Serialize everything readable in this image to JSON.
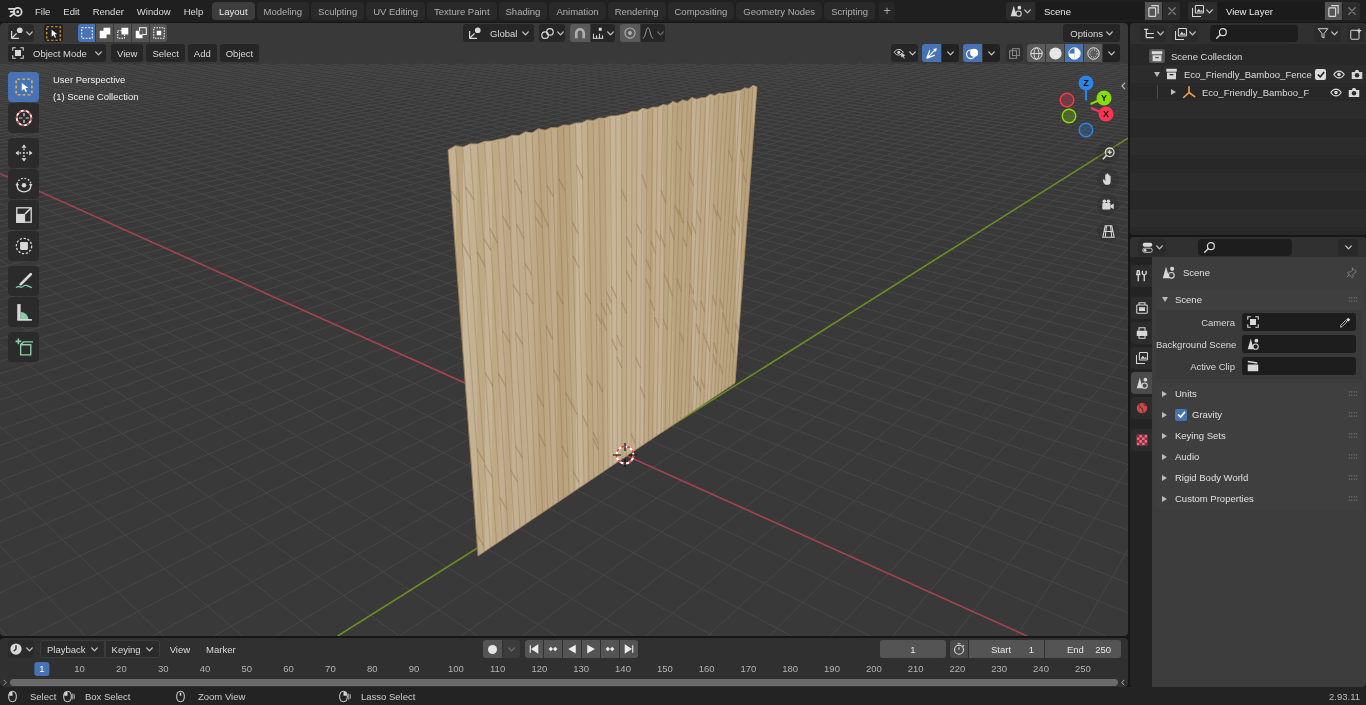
{
  "top_bar": {
    "menus": [
      "File",
      "Edit",
      "Render",
      "Window",
      "Help"
    ],
    "workspaces": [
      {
        "label": "Layout",
        "selected": true
      },
      {
        "label": "Modeling",
        "selected": false
      },
      {
        "label": "Sculpting",
        "selected": false
      },
      {
        "label": "UV Editing",
        "selected": false
      },
      {
        "label": "Texture Paint",
        "selected": false
      },
      {
        "label": "Shading",
        "selected": false
      },
      {
        "label": "Animation",
        "selected": false
      },
      {
        "label": "Rendering",
        "selected": false
      },
      {
        "label": "Compositing",
        "selected": false
      },
      {
        "label": "Geometry Nodes",
        "selected": false
      },
      {
        "label": "Scripting",
        "selected": false
      }
    ],
    "add_workspace": "+",
    "scene": "Scene",
    "view_layer": "View Layer"
  },
  "viewport": {
    "select_modes": [
      {
        "selected": true
      },
      {
        "selected": false
      },
      {
        "selected": false
      },
      {
        "selected": false
      },
      {
        "selected": false
      }
    ],
    "transform_orientation": "Global",
    "snap": false,
    "proportional_editing": false,
    "options": "Options",
    "mode": "Object Mode",
    "menus": [
      "View",
      "Select",
      "Add",
      "Object"
    ],
    "gizmos": true,
    "overlays": true,
    "xray": false,
    "shading": [
      {
        "kind": "wireframe",
        "selected": false
      },
      {
        "kind": "solid",
        "selected": false
      },
      {
        "kind": "material",
        "selected": true
      },
      {
        "kind": "rendered",
        "selected": false
      }
    ],
    "tool_groups": [
      {
        "tools": [
          {
            "kind": "select-box",
            "selected": true
          },
          {
            "kind": "cursor",
            "selected": false
          }
        ]
      },
      {
        "tools": [
          {
            "kind": "move",
            "selected": false
          },
          {
            "kind": "rotate",
            "selected": false
          },
          {
            "kind": "scale",
            "selected": false
          },
          {
            "kind": "transform",
            "selected": false
          }
        ]
      },
      {
        "tools": [
          {
            "kind": "annotate",
            "selected": false
          },
          {
            "kind": "measure",
            "selected": false
          }
        ]
      },
      {
        "tools": [
          {
            "kind": "add-cube",
            "selected": false
          }
        ]
      }
    ],
    "info": [
      "User Perspective",
      "(1) Scene Collection"
    ],
    "axes": [
      {
        "label": "Z",
        "color": "#2f83e3"
      },
      {
        "label": "Y",
        "color": "#8bdc00"
      },
      {
        "label": "X",
        "color": "#ff3352"
      }
    ]
  },
  "timeline": {
    "menus": [
      {
        "label": "Playback",
        "kind": "dropdown"
      },
      {
        "label": "Keying",
        "kind": "dropdown"
      },
      {
        "label": "View",
        "kind": "menu"
      },
      {
        "label": "Marker",
        "kind": "menu"
      }
    ],
    "auto_keying": false,
    "current_frame": "1",
    "start_label": "Start",
    "start": "1",
    "end_label": "End",
    "end": "250",
    "ruler": [
      {
        "label": "1",
        "selected": true
      },
      {
        "label": "10",
        "selected": false
      },
      {
        "label": "20",
        "selected": false
      },
      {
        "label": "30",
        "selected": false
      },
      {
        "label": "40",
        "selected": false
      },
      {
        "label": "50",
        "selected": false
      },
      {
        "label": "60",
        "selected": false
      },
      {
        "label": "70",
        "selected": false
      },
      {
        "label": "80",
        "selected": false
      },
      {
        "label": "90",
        "selected": false
      },
      {
        "label": "100",
        "selected": false
      },
      {
        "label": "110",
        "selected": false
      },
      {
        "label": "120",
        "selected": false
      },
      {
        "label": "130",
        "selected": false
      },
      {
        "label": "140",
        "selected": false
      },
      {
        "label": "150",
        "selected": false
      },
      {
        "label": "160",
        "selected": false
      },
      {
        "label": "170",
        "selected": false
      },
      {
        "label": "180",
        "selected": false
      },
      {
        "label": "190",
        "selected": false
      },
      {
        "label": "200",
        "selected": false
      },
      {
        "label": "210",
        "selected": false
      },
      {
        "label": "220",
        "selected": false
      },
      {
        "label": "230",
        "selected": false
      },
      {
        "label": "240",
        "selected": false
      },
      {
        "label": "250",
        "selected": false
      }
    ]
  },
  "status_bar": {
    "hints": [
      {
        "label": "Select",
        "kind": "left-click"
      },
      {
        "label": "Box Select",
        "kind": "left-drag"
      },
      {
        "label": "Zoom View",
        "kind": "middle"
      },
      {
        "label": "Lasso Select",
        "kind": "right-drag"
      }
    ],
    "version": "2.93.11"
  },
  "outliner": {
    "tree": [
      {
        "label": "Scene Collection",
        "kind": "scene-collection",
        "children": [
          {
            "label": "Eco_Friendly_Bamboo_Fence",
            "kind": "collection",
            "expanded": true,
            "checked": true,
            "visible": true,
            "renderable": true,
            "children": [
              {
                "label": "Eco_Friendly_Bamboo_F",
                "kind": "empty",
                "expanded": false,
                "visible": true,
                "renderable": true
              }
            ]
          }
        ]
      }
    ]
  },
  "properties": {
    "tab_groups": [
      {
        "tabs": [
          {
            "kind": "tool",
            "selected": false
          }
        ]
      },
      {
        "tabs": [
          {
            "kind": "render",
            "selected": false
          },
          {
            "kind": "output",
            "selected": false
          },
          {
            "kind": "view-layer",
            "selected": false
          },
          {
            "kind": "scene",
            "selected": true
          },
          {
            "kind": "world",
            "selected": false
          }
        ]
      },
      {
        "tabs": [
          {
            "kind": "texture",
            "selected": false
          }
        ]
      }
    ],
    "context": "Scene",
    "panels": [
      {
        "label": "Scene",
        "expanded": true,
        "fields": [
          {
            "label": "Camera",
            "kind": "camera"
          },
          {
            "label": "Background Scene",
            "kind": "scene"
          },
          {
            "label": "Active Clip",
            "kind": "clip"
          }
        ]
      },
      {
        "label": "Units",
        "expanded": false
      },
      {
        "label": "Gravity",
        "expanded": false,
        "toggle": {
          "checked": true
        }
      },
      {
        "label": "Keying Sets",
        "expanded": false
      },
      {
        "label": "Audio",
        "expanded": false
      },
      {
        "label": "Rigid Body World",
        "expanded": false
      },
      {
        "label": "Custom Properties",
        "expanded": false
      }
    ]
  }
}
